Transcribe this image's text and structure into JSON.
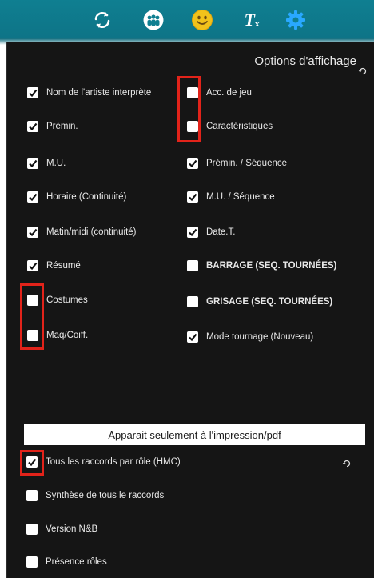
{
  "toolbar": {
    "icons": [
      "sync-icon",
      "group-icon",
      "smiley-icon",
      "clear-format-icon",
      "gear-icon"
    ],
    "clear_format_label": "T",
    "clear_format_sub": "x",
    "colors": {
      "teal": "#0f7f91",
      "gear": "#29a8ff",
      "smiley": "#f2c21b"
    }
  },
  "panel": {
    "title": "Options d'affichage",
    "left_options": [
      {
        "label": "Nom de l'artiste interprète",
        "checked": true
      },
      {
        "label": "Prémin.",
        "checked": true
      },
      {
        "label": "M.U.",
        "checked": true
      },
      {
        "label": "Horaire (Continuité)",
        "checked": true
      },
      {
        "label": "Matin/midi (continuité)",
        "checked": true
      },
      {
        "label": "Résumé",
        "checked": true
      },
      {
        "label": "Costumes",
        "checked": false
      },
      {
        "label": "Maq/Coiff.",
        "checked": false
      }
    ],
    "right_options": [
      {
        "label": "Acc. de jeu",
        "checked": false
      },
      {
        "label": "Caractéristiques",
        "checked": false
      },
      {
        "label": "Prémin. / Séquence",
        "checked": true
      },
      {
        "label": "M.U. / Séquence",
        "checked": true
      },
      {
        "label": "Date.T.",
        "checked": true
      },
      {
        "label": "BARRAGE (SEQ. TOURNÉES)",
        "checked": false,
        "bold": true
      },
      {
        "label": "GRISAGE (SEQ. TOURNÉES)",
        "checked": false,
        "bold": true
      },
      {
        "label": "Mode tournage (Nouveau)",
        "checked": true
      }
    ],
    "print_section": {
      "header": "Apparait seulement à l'impression/pdf",
      "options": [
        {
          "label": "Tous les raccords par rôle (HMC)",
          "checked": true
        },
        {
          "label": "Synthèse de tous le raccords",
          "checked": false
        },
        {
          "label": "Version N&B",
          "checked": false
        },
        {
          "label": "Présence rôles",
          "checked": false
        }
      ]
    },
    "highlight_color": "#e2231a"
  }
}
